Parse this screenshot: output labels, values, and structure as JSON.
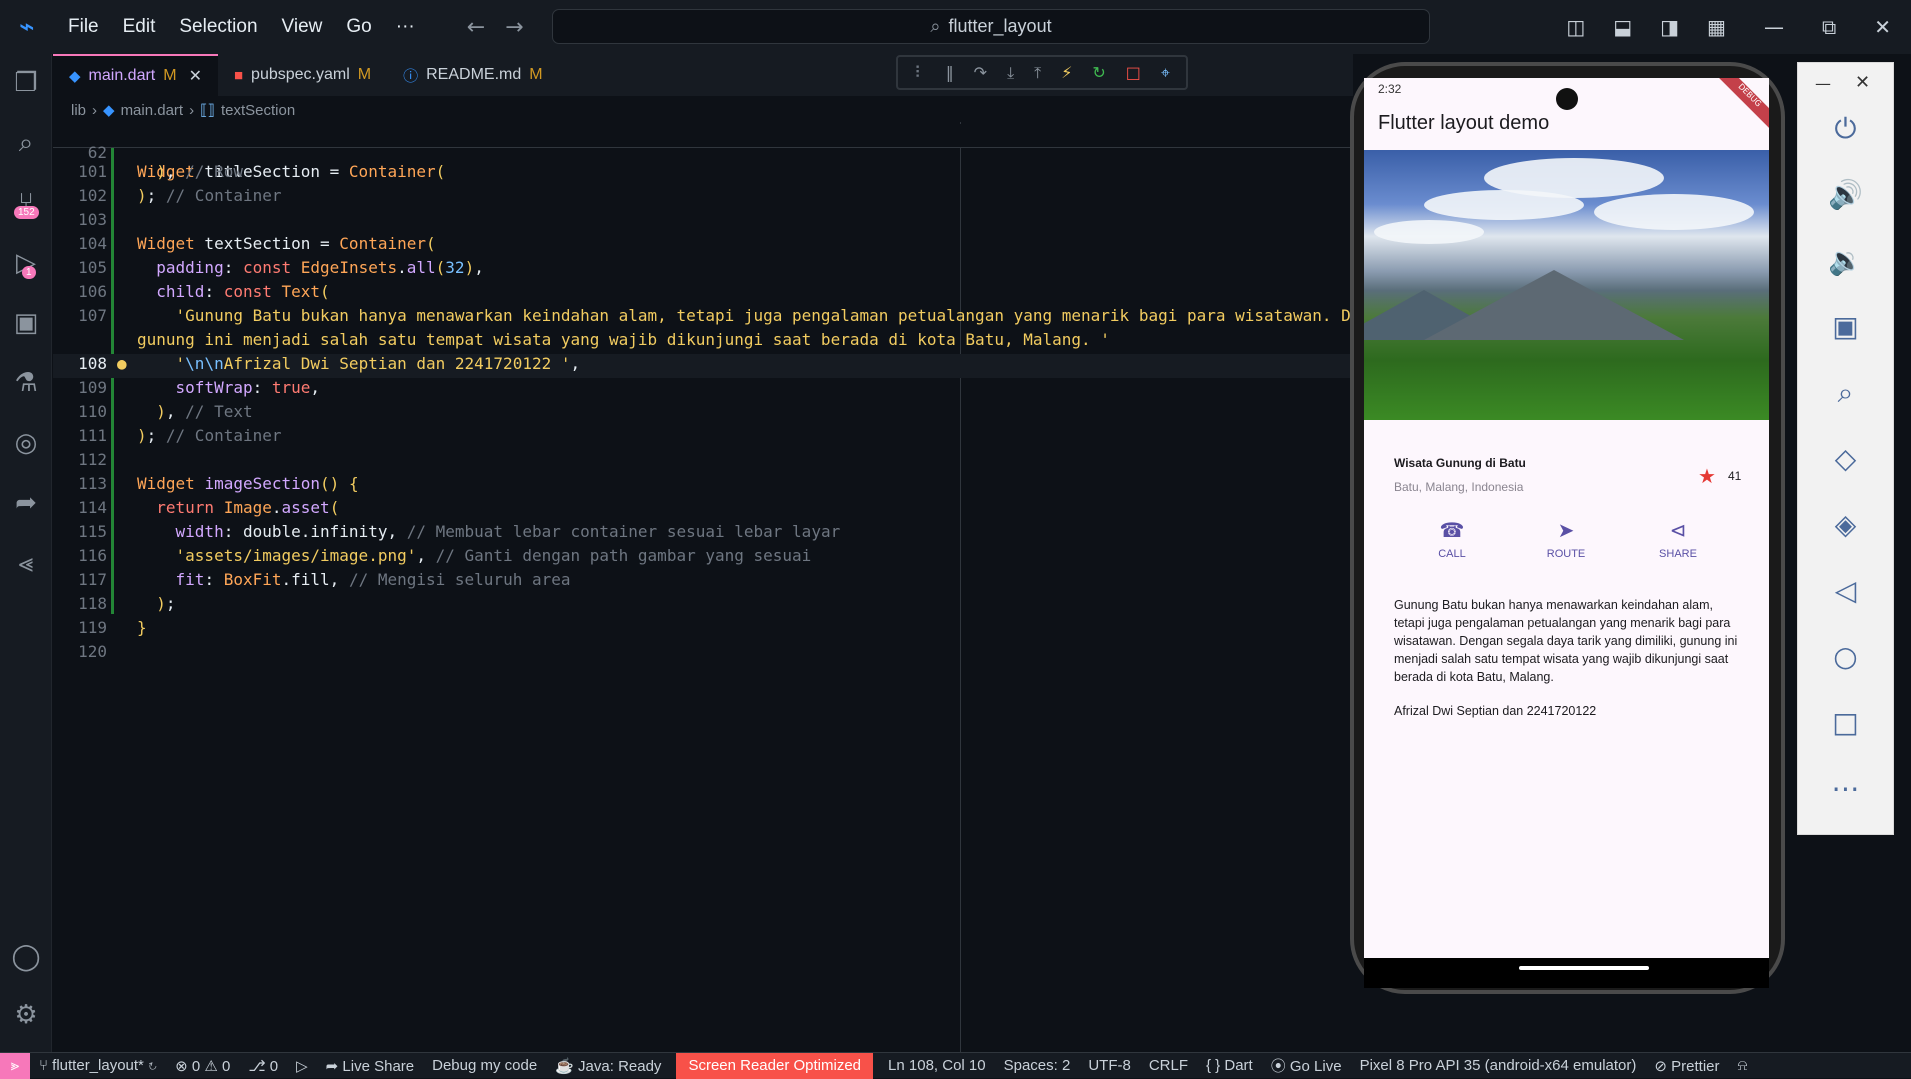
{
  "titlebar": {
    "menu": [
      "File",
      "Edit",
      "Selection",
      "View",
      "Go",
      "···"
    ],
    "search": "flutter_layout"
  },
  "activity": {
    "scm_badge": "152",
    "debug_badge": "1"
  },
  "tabs": [
    {
      "label": "main.dart",
      "mod": "M",
      "close": "✕"
    },
    {
      "label": "pubspec.yaml",
      "mod": "M"
    },
    {
      "label": "README.md",
      "mod": "M"
    }
  ],
  "breadcrumb": {
    "folder": "lib",
    "file": "main.dart",
    "symbol": "textSection"
  },
  "sticky": {
    "num": "62",
    "text": "Widget titleSection = Container("
  },
  "code_lines": [
    {
      "num": "101",
      "text": "  ), // Row"
    },
    {
      "num": "102",
      "text": "); // Container"
    },
    {
      "num": "103",
      "text": ""
    },
    {
      "num": "104",
      "text": "Widget textSection = Container("
    },
    {
      "num": "105",
      "text": "  padding: const EdgeInsets.all(32),"
    },
    {
      "num": "106",
      "text": "  child: const Text("
    },
    {
      "num": "107",
      "text": "    'Gunung Batu bukan hanya menawarkan keindahan alam, tetapi juga pengalaman petualangan yang menarik bagi para wisatawan. D"
    },
    {
      "num": "",
      "text": "gunung ini menjadi salah satu tempat wisata yang wajib dikunjungi saat berada di kota Batu, Malang. '"
    },
    {
      "num": "108",
      "text": "    '\\n\\nAfrizal Dwi Septian dan 2241720122 ',"
    },
    {
      "num": "109",
      "text": "    softWrap: true,"
    },
    {
      "num": "110",
      "text": "  ), // Text"
    },
    {
      "num": "111",
      "text": "); // Container"
    },
    {
      "num": "112",
      "text": ""
    },
    {
      "num": "113",
      "text": "Widget imageSection() {"
    },
    {
      "num": "114",
      "text": "  return Image.asset("
    },
    {
      "num": "115",
      "text": "    width: double.infinity, // Membuat lebar container sesuai lebar layar"
    },
    {
      "num": "116",
      "text": "    'assets/images/image.png', // Ganti dengan path gambar yang sesuai"
    },
    {
      "num": "117",
      "text": "    fit: BoxFit.fill, // Mengisi seluruh area"
    },
    {
      "num": "118",
      "text": "  );"
    },
    {
      "num": "119",
      "text": "}"
    },
    {
      "num": "120",
      "text": ""
    }
  ],
  "status": {
    "branch": "flutter_layout*",
    "errors": "0",
    "warnings": "0",
    "ports": "0",
    "live_share": "Live Share",
    "debug": "Debug my code",
    "java": "Java: Ready",
    "screen_reader": "Screen Reader Optimized",
    "position": "Ln 108, Col 10",
    "spaces": "Spaces: 2",
    "encoding": "UTF-8",
    "eol": "CRLF",
    "lang": "Dart",
    "golive": "Go Live",
    "device": "Pixel 8 Pro API 35 (android-x64 emulator)",
    "prettier": "Prettier"
  },
  "phone": {
    "time": "2:32",
    "debug_ribbon": "DEBUG",
    "appbar_title": "Flutter layout demo",
    "place_name": "Wisata Gunung di Batu",
    "place_location": "Batu, Malang, Indonesia",
    "star_count": "41",
    "buttons": [
      {
        "icon": "phone-icon",
        "label": "CALL"
      },
      {
        "icon": "navigation-icon",
        "label": "ROUTE"
      },
      {
        "icon": "share-icon",
        "label": "SHARE"
      }
    ],
    "body": "Gunung Batu bukan hanya menawarkan keindahan alam, tetapi juga pengalaman petualangan yang menarik bagi para wisatawan. Dengan segala daya tarik yang dimiliki, gunung ini menjadi salah satu tempat wisata yang wajib dikunjungi saat berada di kota Batu, Malang.",
    "body2": "Afrizal Dwi Septian dan 2241720122"
  },
  "colors": {
    "accent": "#f778ba",
    "warn": "#f85149",
    "button": "#5a50a5",
    "star": "#e53935"
  }
}
